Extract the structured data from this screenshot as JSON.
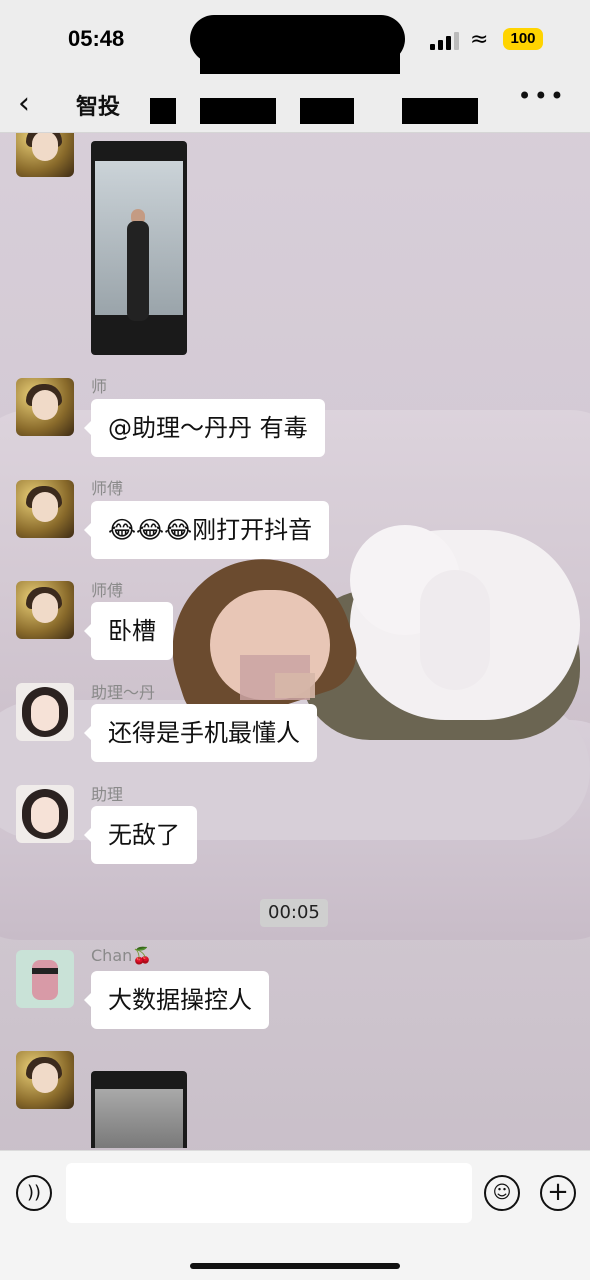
{
  "status_bar": {
    "time": "05:48",
    "battery": "100"
  },
  "nav": {
    "title": "智投",
    "back_icon": "chevron-left-icon",
    "more_icon": "more-dots-icon"
  },
  "messages": [
    {
      "sender": "",
      "type": "video",
      "avatar": "gold"
    },
    {
      "sender": "师",
      "type": "text",
      "text": "@助理～丹丹 有毒",
      "avatar": "gold"
    },
    {
      "sender": "师傅",
      "type": "text",
      "text": "😂😂😂刚打开抖音",
      "avatar": "gold"
    },
    {
      "sender": "师傅",
      "type": "text",
      "text": "卧槽",
      "avatar": "gold"
    },
    {
      "sender": "助理～丹",
      "type": "text",
      "text": "还得是手机最懂人",
      "avatar": "girl"
    },
    {
      "sender": "助理",
      "type": "text",
      "text": "无敌了",
      "avatar": "girl"
    },
    {
      "sender": "Chan🍒",
      "type": "text",
      "text": "大数据操控人",
      "avatar": "cartoon"
    },
    {
      "sender": "",
      "type": "video",
      "avatar": "gold"
    }
  ],
  "time_divider": "00:05",
  "input_bar": {
    "placeholder": "",
    "voice_icon": "voice-icon",
    "emoji_icon": "emoji-icon",
    "plus_icon": "plus-icon"
  }
}
